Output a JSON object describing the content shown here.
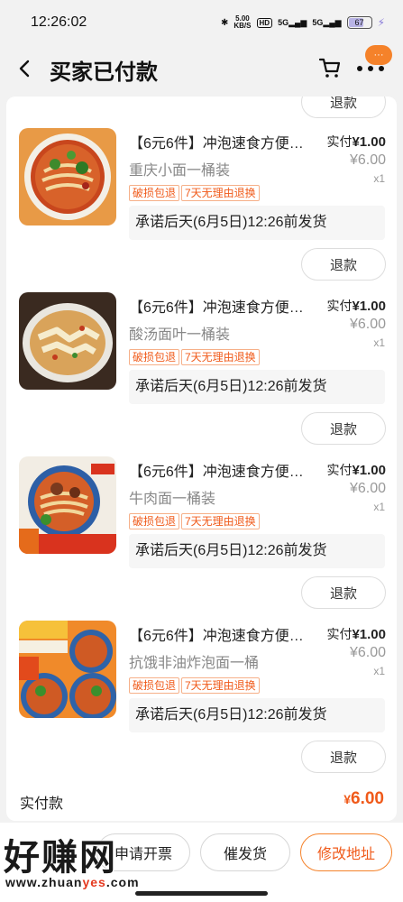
{
  "status_bar": {
    "time": "12:26:02",
    "net_speed_top": "5.00",
    "net_speed_unit": "KB/S",
    "hd": "HD",
    "signal1": "5G",
    "signal2": "5G",
    "battery": "67"
  },
  "header": {
    "title": "买家已付款",
    "badge": "···"
  },
  "items": [
    {
      "title": "【6元6件】冲泡速食方便…",
      "subtitle": "重庆小面一桶装",
      "tag1": "破损包退",
      "tag2": "7天无理由退换",
      "paid_label": "实付",
      "paid_value": "¥1.00",
      "orig_price": "¥6.00",
      "qty": "x1",
      "promise": "承诺后天(6月5日)12:26前发货",
      "refund": "退款",
      "thumb_icon": "chongqing-noodle-thumbnail"
    },
    {
      "title": "【6元6件】冲泡速食方便…",
      "subtitle": "酸汤面叶一桶装",
      "tag1": "破损包退",
      "tag2": "7天无理由退换",
      "paid_label": "实付",
      "paid_value": "¥1.00",
      "orig_price": "¥6.00",
      "qty": "x1",
      "promise": "承诺后天(6月5日)12:26前发货",
      "refund": "退款",
      "thumb_icon": "sour-soup-noodle-thumbnail"
    },
    {
      "title": "【6元6件】冲泡速食方便…",
      "subtitle": "牛肉面一桶装",
      "tag1": "破损包退",
      "tag2": "7天无理由退换",
      "paid_label": "实付",
      "paid_value": "¥1.00",
      "orig_price": "¥6.00",
      "qty": "x1",
      "promise": "承诺后天(6月5日)12:26前发货",
      "refund": "退款",
      "thumb_icon": "beef-noodle-thumbnail"
    },
    {
      "title": "【6元6件】冲泡速食方便…",
      "subtitle": "抗饿非油炸泡面一桶",
      "tag1": "破损包退",
      "tag2": "7天无理由退换",
      "paid_label": "实付",
      "paid_value": "¥1.00",
      "orig_price": "¥6.00",
      "qty": "x1",
      "promise": "承诺后天(6月5日)12:26前发货",
      "refund": "退款",
      "thumb_icon": "non-fried-noodle-thumbnail"
    }
  ],
  "top_refund": "退款",
  "total": {
    "label": "实付款",
    "currency": "¥",
    "value": "6.00"
  },
  "actions": {
    "invoice": "申请开票",
    "urge": "催发货",
    "address": "修改地址"
  },
  "watermark": {
    "text": "好赚网",
    "url_start": "www.zhuan",
    "url_accent": "yes",
    "url_end": ".com"
  },
  "colors": {
    "accent": "#f05a1a",
    "badge": "#f5822a",
    "background": "#f2f2f2"
  }
}
